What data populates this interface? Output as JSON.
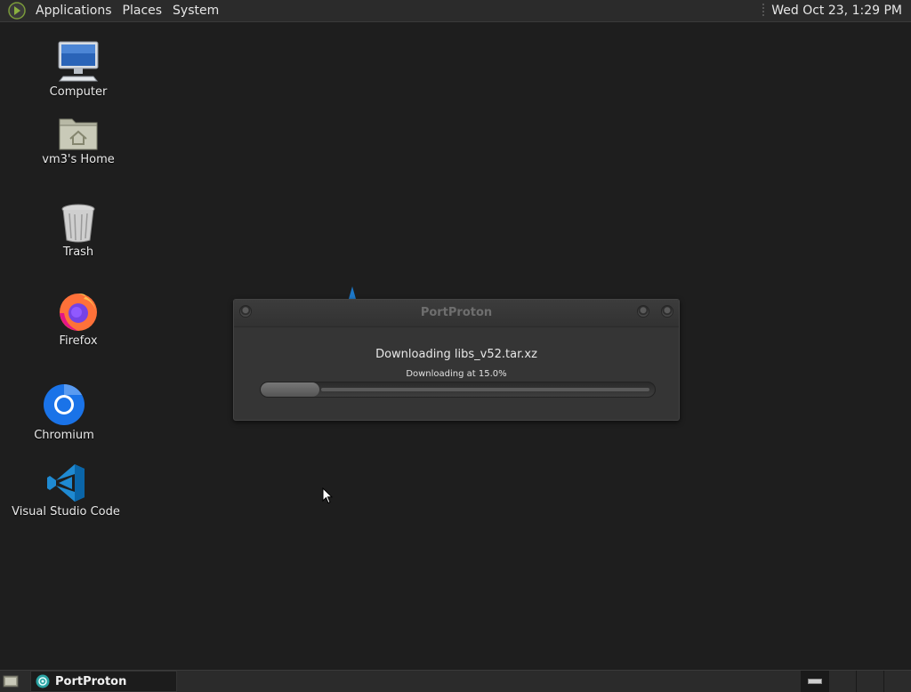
{
  "top_panel": {
    "menus": [
      "Applications",
      "Places",
      "System"
    ],
    "clock": "Wed Oct 23,  1:29 PM"
  },
  "desktop": {
    "icons": [
      {
        "label": "Computer",
        "icon": "computer-icon"
      },
      {
        "label": "vm3's Home",
        "icon": "home-folder-icon"
      },
      {
        "label": "Trash",
        "icon": "trash-icon"
      },
      {
        "label": "Firefox",
        "icon": "firefox-icon"
      },
      {
        "label": "Chromium",
        "icon": "chromium-icon"
      },
      {
        "label": "Visual Studio Code",
        "icon": "vscode-icon"
      }
    ]
  },
  "dialog": {
    "title": "PortProton",
    "message": "Downloading libs_v52.tar.xz",
    "status": "Downloading at 15.0%",
    "progress_fraction": 0.15
  },
  "bottom_panel": {
    "task_label": "PortProton",
    "workspaces": 4,
    "active_workspace": 1
  },
  "colors": {
    "desktop_bg": "#1e1e1e",
    "panel_bg": "#2b2b2b",
    "dialog_bg": "#353535"
  }
}
